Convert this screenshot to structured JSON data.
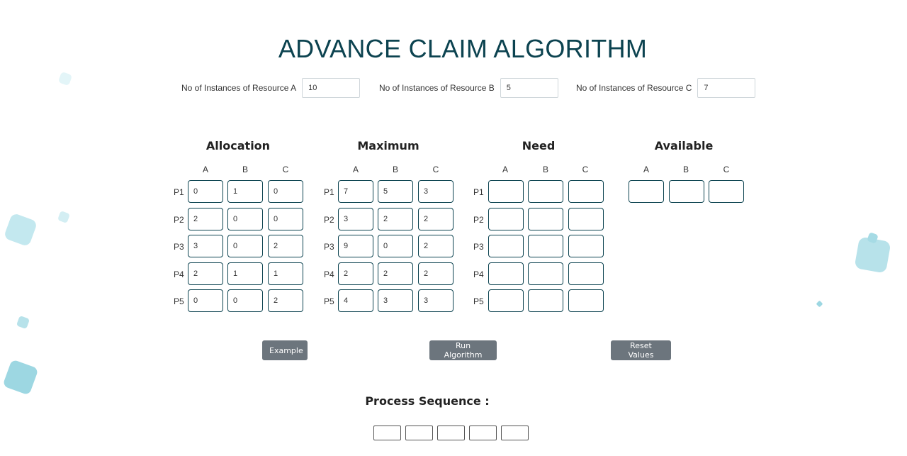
{
  "page": {
    "title": "ADVANCE CLAIM ALGORITHM"
  },
  "resources": [
    {
      "label": "No of Instances of Resource A",
      "value": "10"
    },
    {
      "label": "No of Instances of Resource B",
      "value": "5"
    },
    {
      "label": "No of Instances of Resource C",
      "value": "7"
    }
  ],
  "columns": [
    "A",
    "B",
    "C"
  ],
  "processes": [
    "P1",
    "P2",
    "P3",
    "P4",
    "P5"
  ],
  "matrices": {
    "allocation": {
      "title": "Allocation",
      "values": [
        [
          "0",
          "1",
          "0"
        ],
        [
          "2",
          "0",
          "0"
        ],
        [
          "3",
          "0",
          "2"
        ],
        [
          "2",
          "1",
          "1"
        ],
        [
          "0",
          "0",
          "2"
        ]
      ]
    },
    "maximum": {
      "title": "Maximum",
      "values": [
        [
          "7",
          "5",
          "3"
        ],
        [
          "3",
          "2",
          "2"
        ],
        [
          "9",
          "0",
          "2"
        ],
        [
          "2",
          "2",
          "2"
        ],
        [
          "4",
          "3",
          "3"
        ]
      ]
    },
    "need": {
      "title": "Need",
      "values": [
        [
          "",
          "",
          ""
        ],
        [
          "",
          "",
          ""
        ],
        [
          "",
          "",
          ""
        ],
        [
          "",
          "",
          ""
        ],
        [
          "",
          "",
          ""
        ]
      ]
    },
    "available": {
      "title": "Available",
      "values": [
        [
          "",
          "",
          ""
        ]
      ]
    }
  },
  "buttons": {
    "example": "Example",
    "run": "Run Algorithm",
    "reset": "Reset Values"
  },
  "sequence": {
    "title": "Process Sequence :",
    "slots": [
      "",
      "",
      "",
      "",
      ""
    ]
  },
  "colors": {
    "title": "#0c4350",
    "cell_border": "#0c4350",
    "button_bg": "#6c757d",
    "decor": "#8fd3df"
  }
}
